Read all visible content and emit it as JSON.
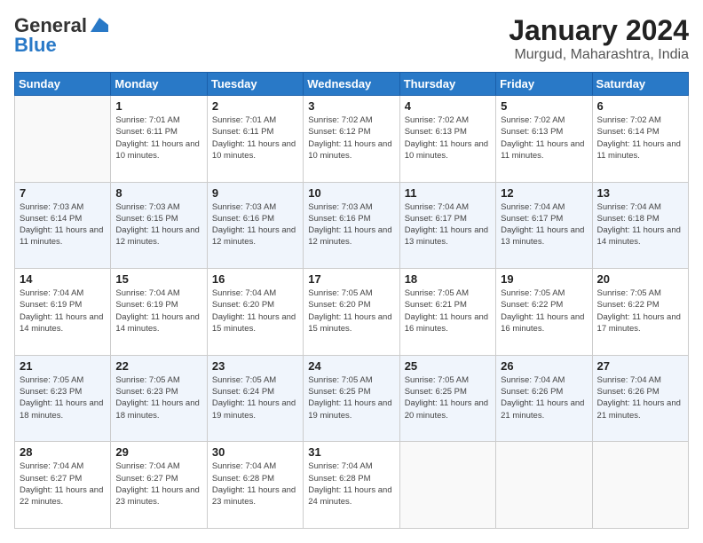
{
  "header": {
    "logo_line1": "General",
    "logo_line2": "Blue",
    "month_title": "January 2024",
    "location": "Murgud, Maharashtra, India"
  },
  "days_of_week": [
    "Sunday",
    "Monday",
    "Tuesday",
    "Wednesday",
    "Thursday",
    "Friday",
    "Saturday"
  ],
  "weeks": [
    [
      {
        "day": "",
        "sunrise": "",
        "sunset": "",
        "daylight": ""
      },
      {
        "day": "1",
        "sunrise": "Sunrise: 7:01 AM",
        "sunset": "Sunset: 6:11 PM",
        "daylight": "Daylight: 11 hours and 10 minutes."
      },
      {
        "day": "2",
        "sunrise": "Sunrise: 7:01 AM",
        "sunset": "Sunset: 6:11 PM",
        "daylight": "Daylight: 11 hours and 10 minutes."
      },
      {
        "day": "3",
        "sunrise": "Sunrise: 7:02 AM",
        "sunset": "Sunset: 6:12 PM",
        "daylight": "Daylight: 11 hours and 10 minutes."
      },
      {
        "day": "4",
        "sunrise": "Sunrise: 7:02 AM",
        "sunset": "Sunset: 6:13 PM",
        "daylight": "Daylight: 11 hours and 10 minutes."
      },
      {
        "day": "5",
        "sunrise": "Sunrise: 7:02 AM",
        "sunset": "Sunset: 6:13 PM",
        "daylight": "Daylight: 11 hours and 11 minutes."
      },
      {
        "day": "6",
        "sunrise": "Sunrise: 7:02 AM",
        "sunset": "Sunset: 6:14 PM",
        "daylight": "Daylight: 11 hours and 11 minutes."
      }
    ],
    [
      {
        "day": "7",
        "sunrise": "Sunrise: 7:03 AM",
        "sunset": "Sunset: 6:14 PM",
        "daylight": "Daylight: 11 hours and 11 minutes."
      },
      {
        "day": "8",
        "sunrise": "Sunrise: 7:03 AM",
        "sunset": "Sunset: 6:15 PM",
        "daylight": "Daylight: 11 hours and 12 minutes."
      },
      {
        "day": "9",
        "sunrise": "Sunrise: 7:03 AM",
        "sunset": "Sunset: 6:16 PM",
        "daylight": "Daylight: 11 hours and 12 minutes."
      },
      {
        "day": "10",
        "sunrise": "Sunrise: 7:03 AM",
        "sunset": "Sunset: 6:16 PM",
        "daylight": "Daylight: 11 hours and 12 minutes."
      },
      {
        "day": "11",
        "sunrise": "Sunrise: 7:04 AM",
        "sunset": "Sunset: 6:17 PM",
        "daylight": "Daylight: 11 hours and 13 minutes."
      },
      {
        "day": "12",
        "sunrise": "Sunrise: 7:04 AM",
        "sunset": "Sunset: 6:17 PM",
        "daylight": "Daylight: 11 hours and 13 minutes."
      },
      {
        "day": "13",
        "sunrise": "Sunrise: 7:04 AM",
        "sunset": "Sunset: 6:18 PM",
        "daylight": "Daylight: 11 hours and 14 minutes."
      }
    ],
    [
      {
        "day": "14",
        "sunrise": "Sunrise: 7:04 AM",
        "sunset": "Sunset: 6:19 PM",
        "daylight": "Daylight: 11 hours and 14 minutes."
      },
      {
        "day": "15",
        "sunrise": "Sunrise: 7:04 AM",
        "sunset": "Sunset: 6:19 PM",
        "daylight": "Daylight: 11 hours and 14 minutes."
      },
      {
        "day": "16",
        "sunrise": "Sunrise: 7:04 AM",
        "sunset": "Sunset: 6:20 PM",
        "daylight": "Daylight: 11 hours and 15 minutes."
      },
      {
        "day": "17",
        "sunrise": "Sunrise: 7:05 AM",
        "sunset": "Sunset: 6:20 PM",
        "daylight": "Daylight: 11 hours and 15 minutes."
      },
      {
        "day": "18",
        "sunrise": "Sunrise: 7:05 AM",
        "sunset": "Sunset: 6:21 PM",
        "daylight": "Daylight: 11 hours and 16 minutes."
      },
      {
        "day": "19",
        "sunrise": "Sunrise: 7:05 AM",
        "sunset": "Sunset: 6:22 PM",
        "daylight": "Daylight: 11 hours and 16 minutes."
      },
      {
        "day": "20",
        "sunrise": "Sunrise: 7:05 AM",
        "sunset": "Sunset: 6:22 PM",
        "daylight": "Daylight: 11 hours and 17 minutes."
      }
    ],
    [
      {
        "day": "21",
        "sunrise": "Sunrise: 7:05 AM",
        "sunset": "Sunset: 6:23 PM",
        "daylight": "Daylight: 11 hours and 18 minutes."
      },
      {
        "day": "22",
        "sunrise": "Sunrise: 7:05 AM",
        "sunset": "Sunset: 6:23 PM",
        "daylight": "Daylight: 11 hours and 18 minutes."
      },
      {
        "day": "23",
        "sunrise": "Sunrise: 7:05 AM",
        "sunset": "Sunset: 6:24 PM",
        "daylight": "Daylight: 11 hours and 19 minutes."
      },
      {
        "day": "24",
        "sunrise": "Sunrise: 7:05 AM",
        "sunset": "Sunset: 6:25 PM",
        "daylight": "Daylight: 11 hours and 19 minutes."
      },
      {
        "day": "25",
        "sunrise": "Sunrise: 7:05 AM",
        "sunset": "Sunset: 6:25 PM",
        "daylight": "Daylight: 11 hours and 20 minutes."
      },
      {
        "day": "26",
        "sunrise": "Sunrise: 7:04 AM",
        "sunset": "Sunset: 6:26 PM",
        "daylight": "Daylight: 11 hours and 21 minutes."
      },
      {
        "day": "27",
        "sunrise": "Sunrise: 7:04 AM",
        "sunset": "Sunset: 6:26 PM",
        "daylight": "Daylight: 11 hours and 21 minutes."
      }
    ],
    [
      {
        "day": "28",
        "sunrise": "Sunrise: 7:04 AM",
        "sunset": "Sunset: 6:27 PM",
        "daylight": "Daylight: 11 hours and 22 minutes."
      },
      {
        "day": "29",
        "sunrise": "Sunrise: 7:04 AM",
        "sunset": "Sunset: 6:27 PM",
        "daylight": "Daylight: 11 hours and 23 minutes."
      },
      {
        "day": "30",
        "sunrise": "Sunrise: 7:04 AM",
        "sunset": "Sunset: 6:28 PM",
        "daylight": "Daylight: 11 hours and 23 minutes."
      },
      {
        "day": "31",
        "sunrise": "Sunrise: 7:04 AM",
        "sunset": "Sunset: 6:28 PM",
        "daylight": "Daylight: 11 hours and 24 minutes."
      },
      {
        "day": "",
        "sunrise": "",
        "sunset": "",
        "daylight": ""
      },
      {
        "day": "",
        "sunrise": "",
        "sunset": "",
        "daylight": ""
      },
      {
        "day": "",
        "sunrise": "",
        "sunset": "",
        "daylight": ""
      }
    ]
  ]
}
